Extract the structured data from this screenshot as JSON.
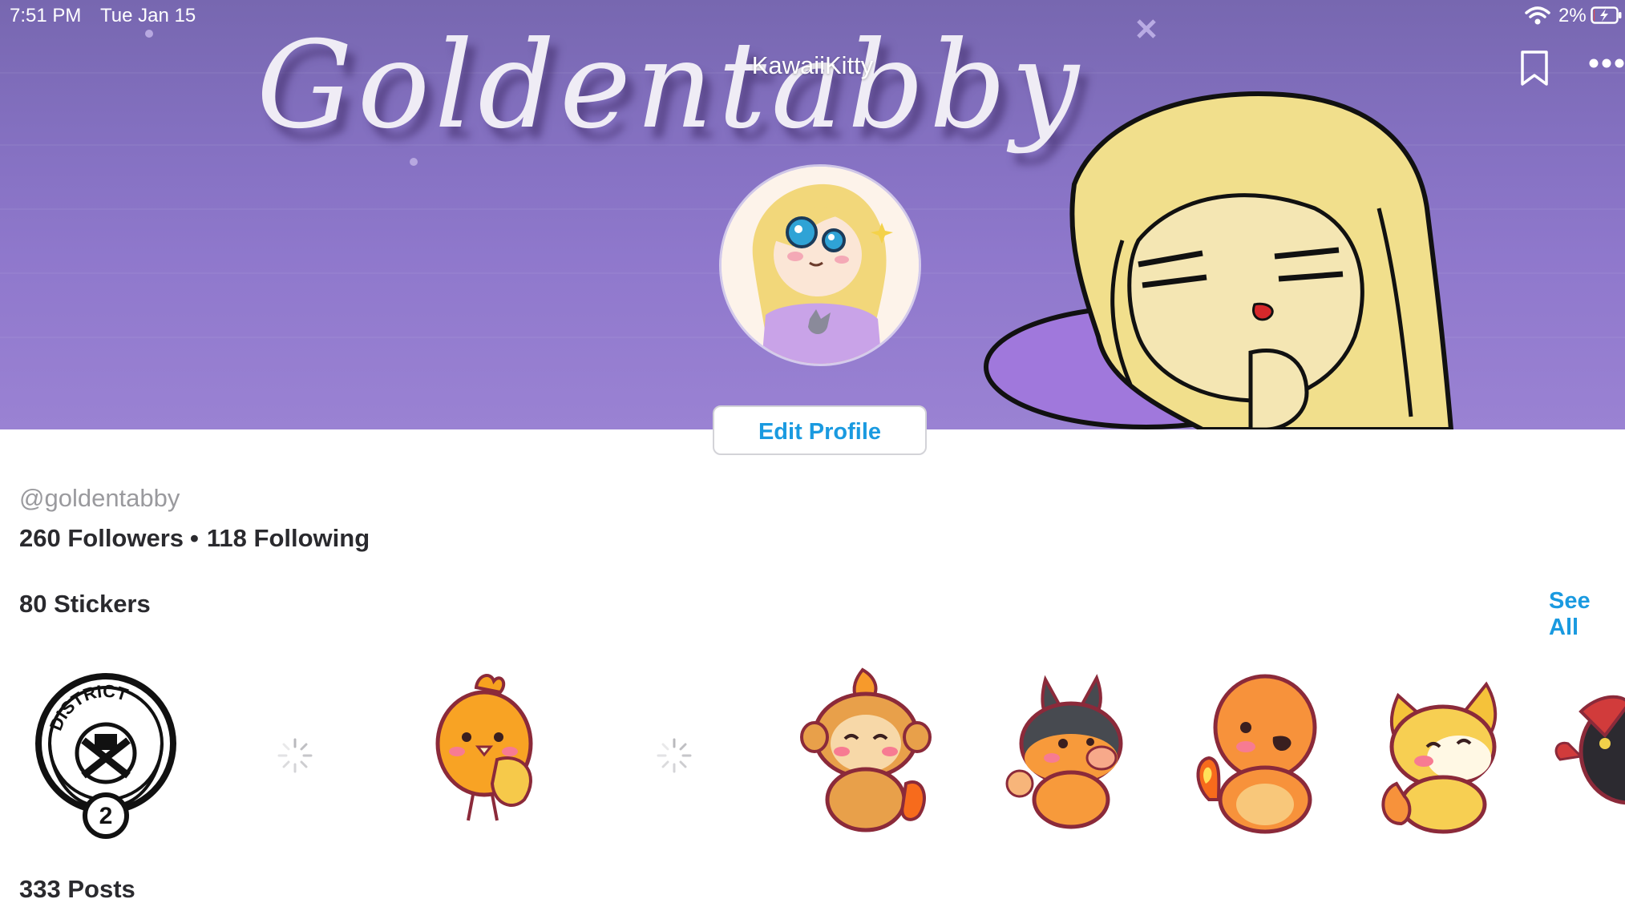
{
  "status_bar": {
    "time": "7:51 PM",
    "date": "Tue Jan 15",
    "battery_percent": "2%",
    "battery_level": 0.02,
    "charging": true
  },
  "header": {
    "banner_text": "Goldentabby",
    "title": "KawaiiKitty",
    "bookmark_icon": "bookmark-icon",
    "more_icon": "more-horizontal-icon",
    "edit_profile_label": "Edit Profile"
  },
  "profile": {
    "handle": "@goldentabby",
    "followers": "260 Followers",
    "separator": "•",
    "following": "118 Following"
  },
  "stickers": {
    "title": "80 Stickers",
    "see_all_label": "See All",
    "items": [
      {
        "name": "district-2-emblem-sticker",
        "emblem_text": "DISTRICT",
        "number": "2"
      },
      {
        "name": "loading-spinner"
      },
      {
        "name": "chick-sticker"
      },
      {
        "name": "loading-spinner"
      },
      {
        "name": "fire-monkey-sticker"
      },
      {
        "name": "fire-pig-sticker"
      },
      {
        "name": "fire-lizard-sticker"
      },
      {
        "name": "fire-fox-sticker"
      },
      {
        "name": "dark-creature-sticker"
      }
    ]
  },
  "posts": {
    "title": "333 Posts"
  },
  "colors": {
    "accent": "#1a9ae0",
    "banner_purple": "#8a74c8",
    "text_dark": "#2a2a2e",
    "text_muted": "#9a9a9e"
  }
}
